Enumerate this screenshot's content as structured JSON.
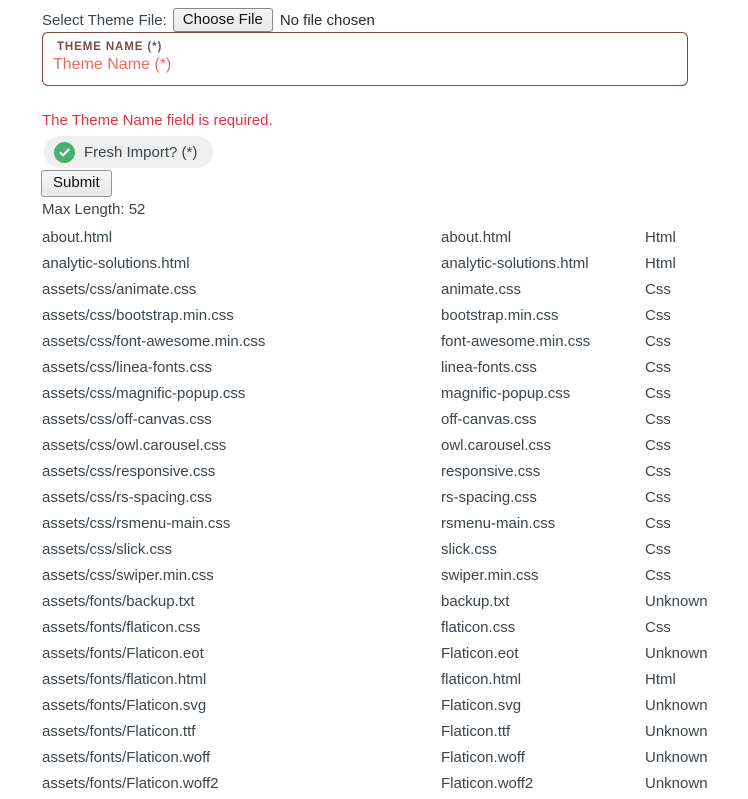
{
  "file_picker": {
    "label": "Select Theme File:",
    "button_label": "Choose File",
    "status_text": "No file chosen"
  },
  "theme_field": {
    "legend": "THEME NAME (*)",
    "placeholder": "Theme Name (*)",
    "value": ""
  },
  "validation": {
    "error_message": "The Theme Name field is required."
  },
  "fresh_import": {
    "label": "Fresh Import? (*)",
    "icon": "check-circle-icon",
    "checked": true,
    "icon_color": "#4caf72"
  },
  "submit": {
    "label": "Submit"
  },
  "max_length": {
    "text": "Max Length: 52"
  },
  "colors": {
    "error_red": "#e03347",
    "placeholder_red": "#ef6a63",
    "legend_brown": "#7a4b46",
    "field_border": "#7d4a45",
    "text": "#3c454c",
    "green": "#4caf72"
  },
  "file_list": [
    {
      "path": "about.html",
      "name": "about.html",
      "type": "Html"
    },
    {
      "path": "analytic-solutions.html",
      "name": "analytic-solutions.html",
      "type": "Html"
    },
    {
      "path": "assets/css/animate.css",
      "name": "animate.css",
      "type": "Css"
    },
    {
      "path": "assets/css/bootstrap.min.css",
      "name": "bootstrap.min.css",
      "type": "Css"
    },
    {
      "path": "assets/css/font-awesome.min.css",
      "name": "font-awesome.min.css",
      "type": "Css"
    },
    {
      "path": "assets/css/linea-fonts.css",
      "name": "linea-fonts.css",
      "type": "Css"
    },
    {
      "path": "assets/css/magnific-popup.css",
      "name": "magnific-popup.css",
      "type": "Css"
    },
    {
      "path": "assets/css/off-canvas.css",
      "name": "off-canvas.css",
      "type": "Css"
    },
    {
      "path": "assets/css/owl.carousel.css",
      "name": "owl.carousel.css",
      "type": "Css"
    },
    {
      "path": "assets/css/responsive.css",
      "name": "responsive.css",
      "type": "Css"
    },
    {
      "path": "assets/css/rs-spacing.css",
      "name": "rs-spacing.css",
      "type": "Css"
    },
    {
      "path": "assets/css/rsmenu-main.css",
      "name": "rsmenu-main.css",
      "type": "Css"
    },
    {
      "path": "assets/css/slick.css",
      "name": "slick.css",
      "type": "Css"
    },
    {
      "path": "assets/css/swiper.min.css",
      "name": "swiper.min.css",
      "type": "Css"
    },
    {
      "path": "assets/fonts/backup.txt",
      "name": "backup.txt",
      "type": "Unknown"
    },
    {
      "path": "assets/fonts/flaticon.css",
      "name": "flaticon.css",
      "type": "Css"
    },
    {
      "path": "assets/fonts/Flaticon.eot",
      "name": "Flaticon.eot",
      "type": "Unknown"
    },
    {
      "path": "assets/fonts/flaticon.html",
      "name": "flaticon.html",
      "type": "Html"
    },
    {
      "path": "assets/fonts/Flaticon.svg",
      "name": "Flaticon.svg",
      "type": "Unknown"
    },
    {
      "path": "assets/fonts/Flaticon.ttf",
      "name": "Flaticon.ttf",
      "type": "Unknown"
    },
    {
      "path": "assets/fonts/Flaticon.woff",
      "name": "Flaticon.woff",
      "type": "Unknown"
    },
    {
      "path": "assets/fonts/Flaticon.woff2",
      "name": "Flaticon.woff2",
      "type": "Unknown"
    }
  ]
}
